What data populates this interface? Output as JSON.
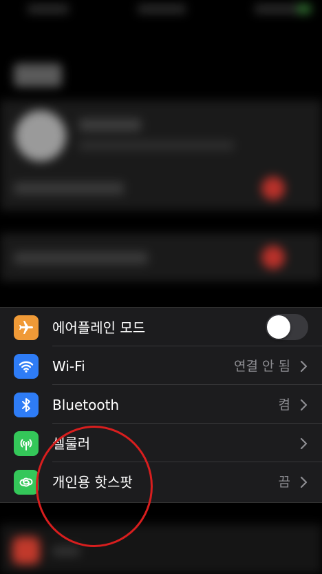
{
  "settings": {
    "rows": [
      {
        "label": "에어플레인 모드",
        "icon": "airplane-icon",
        "icon_color": "#F09A37",
        "control": "toggle",
        "toggle_on": false
      },
      {
        "label": "Wi-Fi",
        "icon": "wifi-icon",
        "icon_color": "#2E7CF6",
        "value": "연결 안 됨"
      },
      {
        "label": "Bluetooth",
        "icon": "bluetooth-icon",
        "icon_color": "#2E7CF6",
        "value": "켬"
      },
      {
        "label": "셀룰러",
        "icon": "cellular-icon",
        "icon_color": "#34C759",
        "value": ""
      },
      {
        "label": "개인용 핫스팟",
        "icon": "hotspot-icon",
        "icon_color": "#34C759",
        "value": "끔"
      }
    ]
  },
  "annotation": {
    "type": "circle",
    "color": "#D81E1E"
  }
}
